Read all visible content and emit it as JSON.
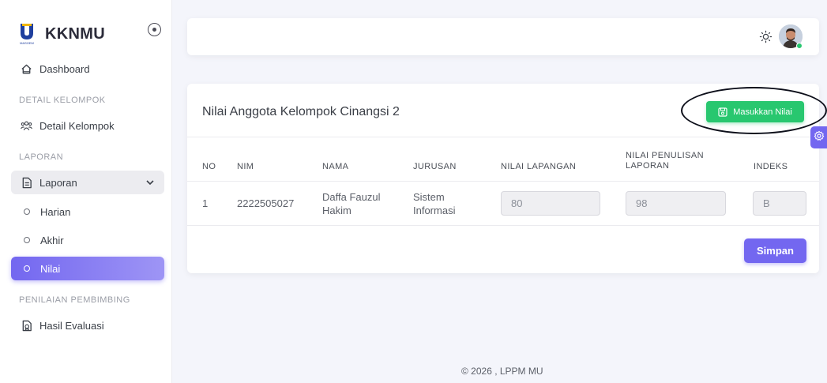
{
  "brand": {
    "title": "KKNMU",
    "logo_text": "MASOEM"
  },
  "sidebar": {
    "dashboard": "Dashboard",
    "section_detail": "DETAIL KELOMPOK",
    "detail_kelompok": "Detail Kelompok",
    "section_laporan": "LAPORAN",
    "laporan": "Laporan",
    "harian": "Harian",
    "akhir": "Akhir",
    "nilai": "Nilai",
    "section_penilaian": "PENILAIAN PEMBIMBING",
    "hasil_evaluasi": "Hasil Evaluasi"
  },
  "card": {
    "title": "Nilai Anggota Kelompok Cinangsi 2",
    "add_button": "Masukkan Nilai",
    "save_button": "Simpan"
  },
  "table": {
    "headers": [
      "NO",
      "NIM",
      "NAMA",
      "JURUSAN",
      "NILAI LAPANGAN",
      "NILAI PENULISAN LAPORAN",
      "INDEKS"
    ],
    "header_penulisan_line1": "NILAI PENULISAN",
    "header_penulisan_line2": "LAPORAN",
    "rows": [
      {
        "no": "1",
        "nim": "2222505027",
        "nama_line1": "Daffa Fauzul",
        "nama_line2": "Hakim",
        "jurusan_line1": "Sistem",
        "jurusan_line2": "Informasi",
        "nilai_lapangan": "80",
        "nilai_penulisan": "98",
        "indeks": "B"
      }
    ]
  },
  "footer": {
    "text": "© 2026 , LPPM MU"
  },
  "colors": {
    "primary": "#7367f0",
    "success": "#28c76f",
    "annotation": "#0d0f1a"
  },
  "icons": {
    "dashboard": "home-icon",
    "detail_kelompok": "users-icon",
    "laporan": "file-text-icon",
    "hasil_evaluasi": "file-certificate-icon",
    "theme": "sun-icon",
    "save": "floppy-icon",
    "settings": "gear-icon"
  }
}
